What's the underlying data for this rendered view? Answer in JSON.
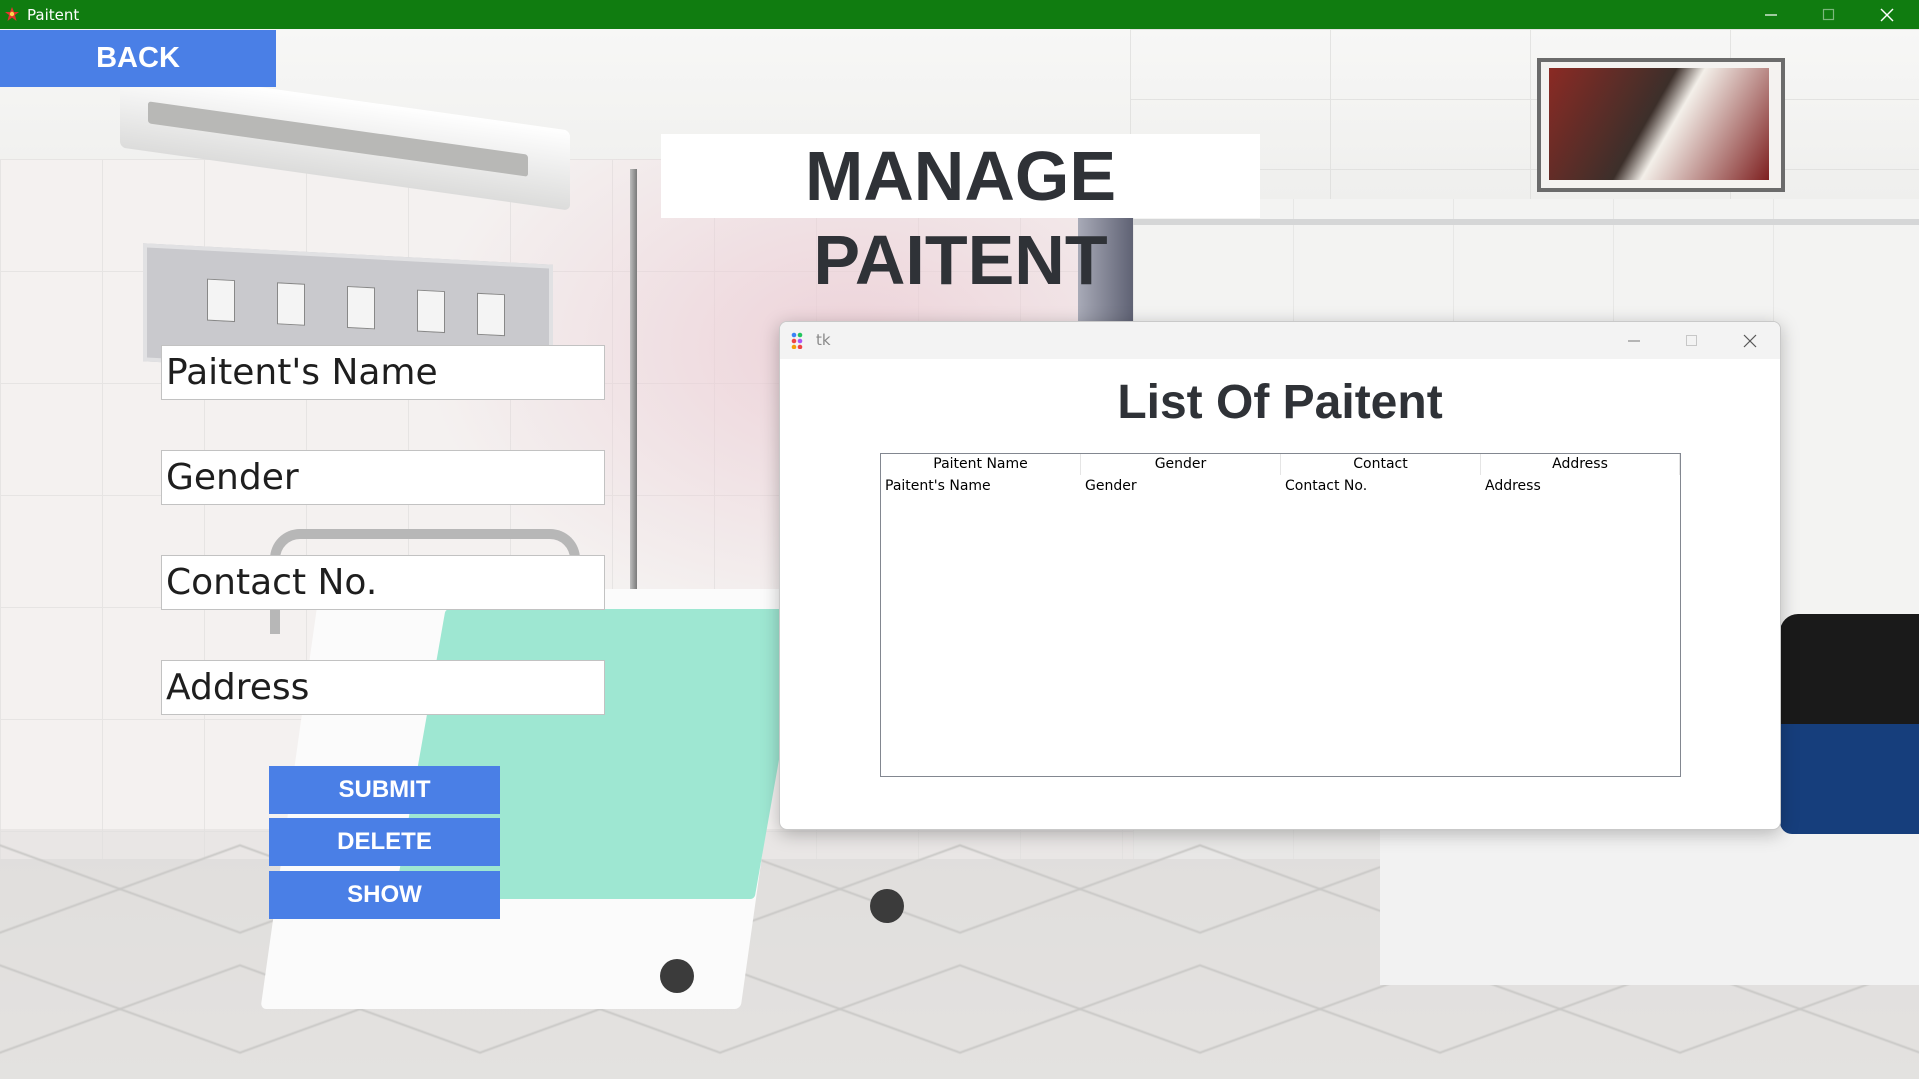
{
  "window": {
    "title": "Paitent",
    "controls": [
      "minimize-icon",
      "maximize-icon",
      "close-icon"
    ]
  },
  "back_button": {
    "label": "BACK"
  },
  "page_title": "MANAGE PAITENT",
  "form": {
    "fields": [
      {
        "name": "patient-name-field",
        "value": "Paitent's Name"
      },
      {
        "name": "gender-field",
        "value": "Gender"
      },
      {
        "name": "contact-field",
        "value": "Contact No."
      },
      {
        "name": "address-field",
        "value": "Address"
      }
    ],
    "buttons": {
      "submit": "SUBMIT",
      "delete": "DELETE",
      "show": "SHOW"
    }
  },
  "list_window": {
    "title": "tk",
    "heading": "List Of Paitent",
    "columns": [
      "Paitent Name",
      "Gender",
      "Contact",
      "Address"
    ],
    "rows": [
      [
        "Paitent's Name",
        "Gender",
        "Contact No.",
        "Address"
      ]
    ]
  },
  "colors": {
    "titlebar": "#107c10",
    "button_blue": "#4a7fe6",
    "heading_text": "#2f3237"
  }
}
